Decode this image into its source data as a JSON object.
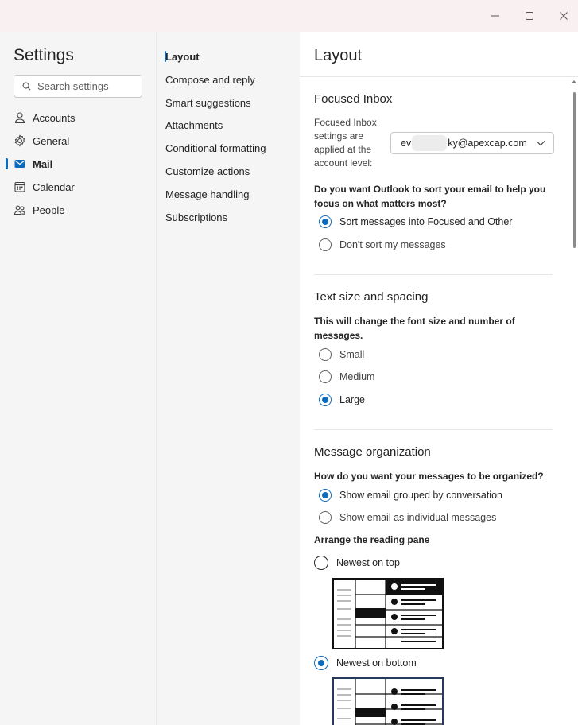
{
  "window": {
    "controls": [
      "minimize-icon",
      "maximize-icon",
      "close-icon"
    ]
  },
  "sidebar": {
    "title": "Settings",
    "search_placeholder": "Search settings",
    "items": [
      {
        "label": "Accounts",
        "icon": "person-icon"
      },
      {
        "label": "General",
        "icon": "gear-icon"
      },
      {
        "label": "Mail",
        "icon": "mail-icon",
        "active": true
      },
      {
        "label": "Calendar",
        "icon": "calendar-icon"
      },
      {
        "label": "People",
        "icon": "people-icon"
      }
    ]
  },
  "subnav": {
    "items": [
      {
        "label": "Layout",
        "active": true
      },
      {
        "label": "Compose and reply"
      },
      {
        "label": "Smart suggestions"
      },
      {
        "label": "Attachments"
      },
      {
        "label": "Conditional formatting"
      },
      {
        "label": "Customize actions"
      },
      {
        "label": "Message handling"
      },
      {
        "label": "Subscriptions"
      }
    ]
  },
  "main": {
    "title": "Layout",
    "focused_inbox": {
      "title": "Focused Inbox",
      "account_note": [
        "Focused Inbox",
        "settings are",
        "applied at the",
        "account level:"
      ],
      "account_prefix": "ev",
      "account_suffix": "ky@apexcap.com",
      "question": "Do you want Outlook to sort your email to help you focus on what matters most?",
      "options": [
        {
          "label": "Sort messages into Focused and Other",
          "selected": true
        },
        {
          "label": "Don't sort my messages",
          "selected": false
        }
      ]
    },
    "text_size": {
      "title": "Text size and spacing",
      "question": "This will change the font size and number of messages.",
      "options": [
        {
          "label": "Small",
          "selected": false
        },
        {
          "label": "Medium",
          "selected": false
        },
        {
          "label": "Large",
          "selected": true
        }
      ]
    },
    "organization": {
      "title": "Message organization",
      "question": "How do you want your messages to be organized?",
      "options": [
        {
          "label": "Show email grouped by conversation",
          "selected": true
        },
        {
          "label": "Show email as individual messages",
          "selected": false
        }
      ],
      "reading_pane_label": "Arrange the reading pane",
      "reading_pane_options": [
        {
          "label": "Newest on top",
          "selected": false
        },
        {
          "label": "Newest on bottom",
          "selected": true
        }
      ]
    }
  },
  "colors": {
    "accent": "#0f6cbd",
    "sidebar_bg": "#f5f5f5",
    "titlebar_bg": "#f9f1f1"
  }
}
